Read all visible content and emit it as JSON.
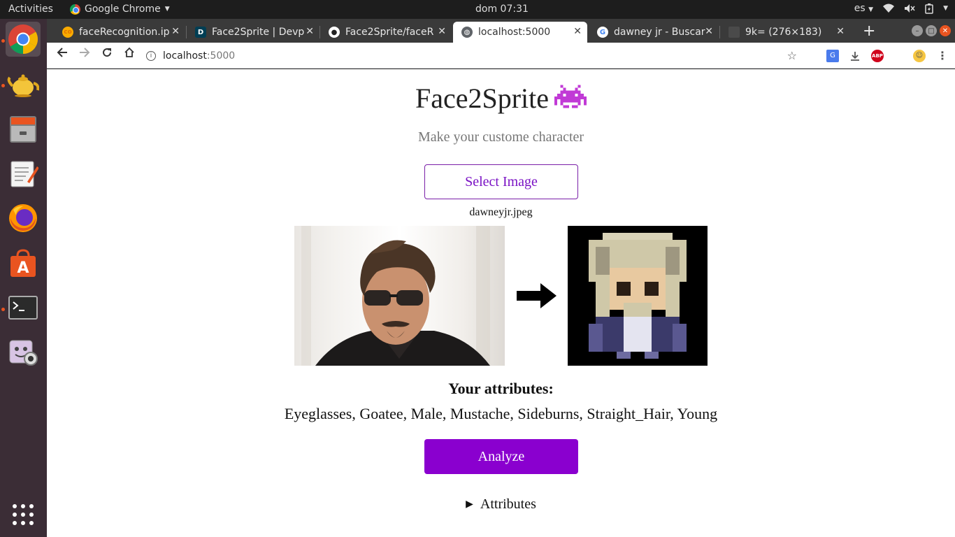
{
  "topbar": {
    "activities": "Activities",
    "app_name": "Google Chrome",
    "clock": "dom 07:31",
    "lang": "es"
  },
  "dock": {
    "items": [
      "chrome-icon",
      "teapot-icon",
      "file-cabinet-icon",
      "text-editor-icon",
      "firefox-icon",
      "software-center-icon",
      "terminal-icon",
      "webcam-app-icon",
      "show-apps-icon"
    ]
  },
  "tabs": [
    {
      "title": "faceRecognition.ip",
      "favicon": "colab-icon",
      "active": false
    },
    {
      "title": "Face2Sprite | Devp",
      "favicon": "devpost-icon",
      "active": false
    },
    {
      "title": "Face2Sprite/faceR",
      "favicon": "github-icon",
      "active": false
    },
    {
      "title": "localhost:5000",
      "favicon": "globe-icon",
      "active": true
    },
    {
      "title": "dawney jr - Buscar",
      "favicon": "google-icon",
      "active": false
    },
    {
      "title": "9k= (276×183)",
      "favicon": "image-icon",
      "active": false
    }
  ],
  "toolbar": {
    "url_host": "localhost",
    "url_port": ":5000"
  },
  "page": {
    "title": "Face2Sprite",
    "subtitle": "Make your custome character",
    "select_label": "Select Image",
    "filename": "dawneyjr.jpeg",
    "attr_heading": "Your attributes:",
    "attributes": "Eyeglasses, Goatee, Male, Mustache, Sideburns, Straight_Hair, Young",
    "analyze_label": "Analyze",
    "details_label": "Attributes"
  },
  "colors": {
    "accent": "#8a00cf",
    "dock_bg": "#3b2d36",
    "ubuntu_orange": "#e95420"
  }
}
